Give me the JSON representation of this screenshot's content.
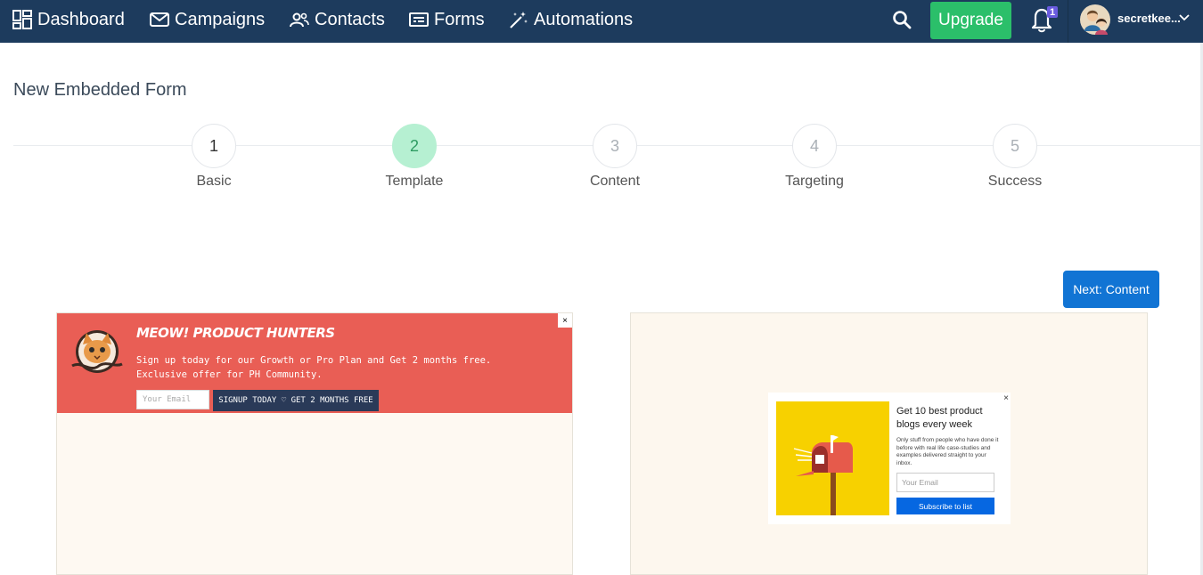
{
  "nav": {
    "items": [
      {
        "label": "Dashboard",
        "icon": "dashboard-icon"
      },
      {
        "label": "Campaigns",
        "icon": "envelope-icon"
      },
      {
        "label": "Contacts",
        "icon": "people-icon"
      },
      {
        "label": "Forms",
        "icon": "form-icon"
      },
      {
        "label": "Automations",
        "icon": "magic-wand-icon"
      }
    ],
    "upgrade_label": "Upgrade",
    "notification_count": "1",
    "user_name": "secretkee..."
  },
  "page": {
    "title": "New Embedded Form"
  },
  "steps": [
    {
      "number": "1",
      "label": "Basic",
      "state": "done"
    },
    {
      "number": "2",
      "label": "Template",
      "state": "active"
    },
    {
      "number": "3",
      "label": "Content",
      "state": "pending"
    },
    {
      "number": "4",
      "label": "Targeting",
      "state": "pending"
    },
    {
      "number": "5",
      "label": "Success",
      "state": "pending"
    }
  ],
  "next_button_label": "Next: Content",
  "templates": [
    {
      "headline": "MEOW! PRODUCT HUNTERS",
      "body": "Sign up today for our Growth or Pro Plan and Get 2 months free. Exclusive offer for PH Community.",
      "email_placeholder": "Your Email",
      "button_label": "SIGNUP TODAY ♡ GET 2 MONTHS FREE",
      "close": "×"
    },
    {
      "headline": "Get 10 best product blogs every week",
      "description": "Only stuff from people who have done it before with real life case-studies and examples delivered straight to your inbox.",
      "email_placeholder": "Your Email",
      "button_label": "Subscribe to list",
      "close": "×"
    }
  ],
  "colors": {
    "nav_bg": "#1d3b5d",
    "upgrade": "#2bbf6a",
    "active_step": "#b6f0d2",
    "primary": "#1174d4",
    "banner": "#e95e55",
    "mail_art": "#f7d100"
  }
}
